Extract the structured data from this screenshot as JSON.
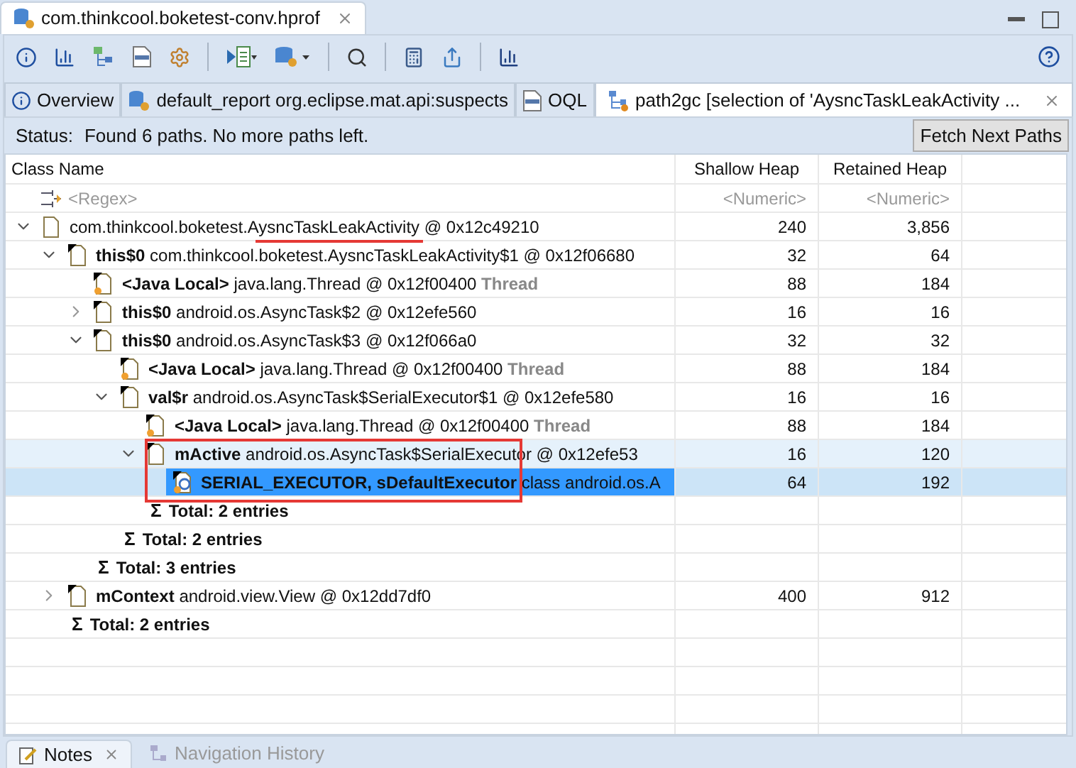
{
  "editor_tab": {
    "title": "com.thinkcool.boketest-conv.hprof"
  },
  "inner_tabs": [
    {
      "kind": "info",
      "label": "Overview",
      "selected": false,
      "closable": false
    },
    {
      "kind": "report",
      "label": "default_report  org.eclipse.mat.api:suspects",
      "selected": false,
      "closable": false
    },
    {
      "kind": "query",
      "label": "OQL",
      "selected": false,
      "closable": false
    },
    {
      "kind": "tree",
      "label": "path2gc [selection of 'AysncTaskLeakActivity ...",
      "selected": true,
      "closable": true
    }
  ],
  "status": {
    "label": "Status:",
    "text": "Found 6 paths. No more paths left.",
    "button": "Fetch Next Paths"
  },
  "table": {
    "columns": [
      {
        "title": "Class Name",
        "filter": "<Regex>"
      },
      {
        "title": "Shallow Heap",
        "filter": "<Numeric>"
      },
      {
        "title": "Retained Heap",
        "filter": "<Numeric>"
      }
    ],
    "rows": [
      {
        "kind": "object",
        "field": "",
        "name": "com.thinkcool.boketest.AysncTaskLeakActivity @ 0x12c49210",
        "shallow": "240",
        "retained": "3,856",
        "expanded": true,
        "selected": false,
        "hovered": false,
        "underlined": true,
        "boxed": false,
        "children": [
          {
            "kind": "reference",
            "field": "this$0",
            "name": "com.thinkcool.boketest.AysncTaskLeakActivity$1 @ 0x12f06680",
            "shallow": "32",
            "retained": "64",
            "expanded": true,
            "selected": false,
            "hovered": false,
            "underlined": false,
            "boxed": false,
            "children": [
              {
                "kind": "gc_root",
                "field": "<Java Local>",
                "name": "java.lang.Thread @ 0x12f00400",
                "suffix": "Thread",
                "shallow": "88",
                "retained": "184",
                "selected": false,
                "hovered": false,
                "underlined": false,
                "boxed": false
              },
              {
                "kind": "reference",
                "field": "this$0",
                "name": "android.os.AsyncTask$2 @ 0x12efe560",
                "shallow": "16",
                "retained": "16",
                "expanded": false,
                "selected": false,
                "hovered": false,
                "underlined": false,
                "boxed": false
              },
              {
                "kind": "reference",
                "field": "this$0",
                "name": "android.os.AsyncTask$3 @ 0x12f066a0",
                "shallow": "32",
                "retained": "32",
                "expanded": true,
                "selected": false,
                "hovered": false,
                "underlined": false,
                "boxed": false,
                "children": [
                  {
                    "kind": "gc_root",
                    "field": "<Java Local>",
                    "name": "java.lang.Thread @ 0x12f00400",
                    "suffix": "Thread",
                    "shallow": "88",
                    "retained": "184",
                    "selected": false,
                    "hovered": false,
                    "underlined": false,
                    "boxed": false
                  },
                  {
                    "kind": "reference",
                    "field": "val$r",
                    "name": "android.os.AsyncTask$SerialExecutor$1 @ 0x12efe580",
                    "shallow": "16",
                    "retained": "16",
                    "expanded": true,
                    "selected": false,
                    "hovered": false,
                    "underlined": false,
                    "boxed": false,
                    "children": [
                      {
                        "kind": "gc_root",
                        "field": "<Java Local>",
                        "name": "java.lang.Thread @ 0x12f00400",
                        "suffix": "Thread",
                        "shallow": "88",
                        "retained": "184",
                        "selected": false,
                        "hovered": false,
                        "underlined": false,
                        "boxed": false
                      },
                      {
                        "kind": "reference",
                        "field": "mActive",
                        "name": "android.os.AsyncTask$SerialExecutor @ 0x12efe53",
                        "shallow": "16",
                        "retained": "120",
                        "expanded": true,
                        "selected": false,
                        "hovered": true,
                        "underlined": false,
                        "boxed": true,
                        "children": [
                          {
                            "kind": "class",
                            "field": "SERIAL_EXECUTOR, sDefaultExecutor",
                            "name": "class android.os.A",
                            "shallow": "64",
                            "retained": "192",
                            "selected": true,
                            "hovered": false,
                            "underlined": false,
                            "boxed": true
                          }
                        ]
                      },
                      {
                        "kind": "total",
                        "symbol": "Σ",
                        "text": "Total: 2 entries"
                      }
                    ]
                  },
                  {
                    "kind": "total",
                    "symbol": "Σ",
                    "text": "Total: 2 entries"
                  }
                ]
              },
              {
                "kind": "total",
                "symbol": "Σ",
                "text": "Total: 3 entries"
              }
            ]
          },
          {
            "kind": "reference",
            "field": "mContext",
            "name": "android.view.View @ 0x12dd7df0",
            "shallow": "400",
            "retained": "912",
            "expanded": false,
            "selected": false,
            "hovered": false,
            "underlined": false,
            "boxed": false
          },
          {
            "kind": "total",
            "symbol": "Σ",
            "text": "Total: 2 entries"
          }
        ]
      }
    ]
  },
  "bottom_tabs": [
    {
      "label": "Notes",
      "selected": true,
      "closable": true
    },
    {
      "label": "Navigation History",
      "selected": false,
      "closable": false
    }
  ]
}
